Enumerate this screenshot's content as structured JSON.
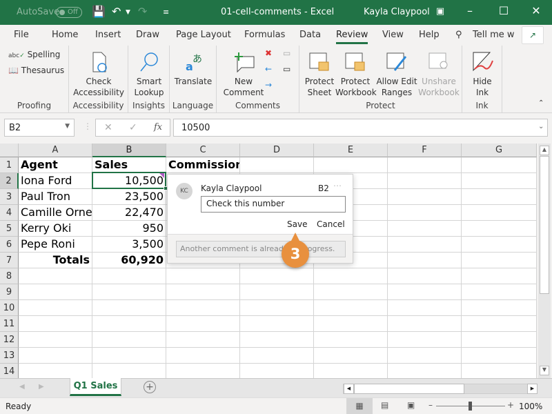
{
  "titlebar": {
    "autosave_label": "AutoSave",
    "autosave_state": "Off",
    "document_title": "01-cell-comments  -  Excel",
    "user_name": "Kayla Claypool"
  },
  "tabs": [
    "File",
    "Home",
    "Insert",
    "Draw",
    "Page Layout",
    "Formulas",
    "Data",
    "Review",
    "View",
    "Help"
  ],
  "active_tab": "Review",
  "tell_me": "Tell me w",
  "ribbon": {
    "proofing": {
      "label": "Proofing",
      "spelling": "Spelling",
      "thesaurus": "Thesaurus"
    },
    "accessibility": {
      "label": "Accessibility",
      "check_line1": "Check",
      "check_line2": "Accessibility"
    },
    "insights": {
      "label": "Insights",
      "smart_line1": "Smart",
      "smart_line2": "Lookup"
    },
    "language": {
      "label": "Language",
      "translate": "Translate"
    },
    "comments": {
      "label": "Comments",
      "new_line1": "New",
      "new_line2": "Comment"
    },
    "protect": {
      "label": "Protect",
      "sheet1": "Protect",
      "sheet2": "Sheet",
      "wb1": "Protect",
      "wb2": "Workbook",
      "allow1": "Allow Edit",
      "allow2": "Ranges",
      "unshare1": "Unshare",
      "unshare2": "Workbook"
    },
    "ink": {
      "label": "Ink",
      "hide1": "Hide",
      "hide2": "Ink"
    }
  },
  "formula_bar": {
    "name_box": "B2",
    "value": "10500"
  },
  "columns": [
    "A",
    "B",
    "C",
    "D",
    "E",
    "F",
    "G"
  ],
  "rows": [
    {
      "num": "1",
      "a": "Agent",
      "b": "Sales",
      "c": "Commission"
    },
    {
      "num": "2",
      "a": "Iona Ford",
      "b": "10,500",
      "c": ""
    },
    {
      "num": "3",
      "a": "Paul Tron",
      "b": "23,500",
      "c": ""
    },
    {
      "num": "4",
      "a": "Camille Orne",
      "b": "22,470",
      "c": ""
    },
    {
      "num": "5",
      "a": "Kerry Oki",
      "b": "950",
      "c": ""
    },
    {
      "num": "6",
      "a": "Pepe Roni",
      "b": "3,500",
      "c": ""
    },
    {
      "num": "7",
      "a": "Totals",
      "b": "60,920",
      "c": ""
    },
    {
      "num": "8"
    },
    {
      "num": "9"
    },
    {
      "num": "10"
    },
    {
      "num": "11"
    },
    {
      "num": "12"
    },
    {
      "num": "13"
    },
    {
      "num": "14"
    }
  ],
  "comment": {
    "initials": "KC",
    "author": "Kayla Claypool",
    "cell_ref": "B2",
    "text": "Check this number",
    "save": "Save",
    "cancel": "Cancel",
    "notice": "Another comment is already in progress."
  },
  "callout_step": "3",
  "sheet_tab": "Q1 Sales",
  "status": "Ready",
  "zoom": "100%",
  "colors": {
    "accent": "#217346",
    "callout": "#e8903e",
    "comment_marker": "#b05cc5"
  }
}
